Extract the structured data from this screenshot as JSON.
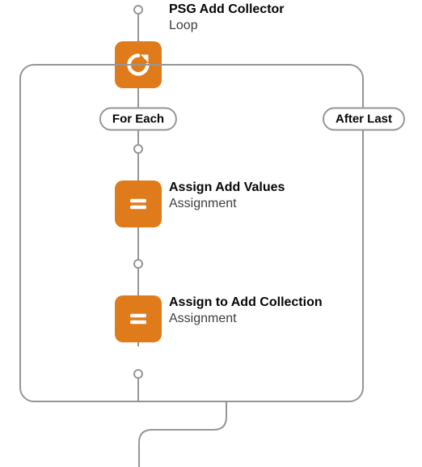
{
  "loop": {
    "title": "PSG Add Collector",
    "subtitle": "Loop",
    "branch_foreach": "For Each",
    "branch_afterlast": "After Last"
  },
  "step1": {
    "title": "Assign Add Values",
    "subtitle": "Assignment"
  },
  "step2": {
    "title": "Assign to Add Collection",
    "subtitle": "Assignment"
  }
}
